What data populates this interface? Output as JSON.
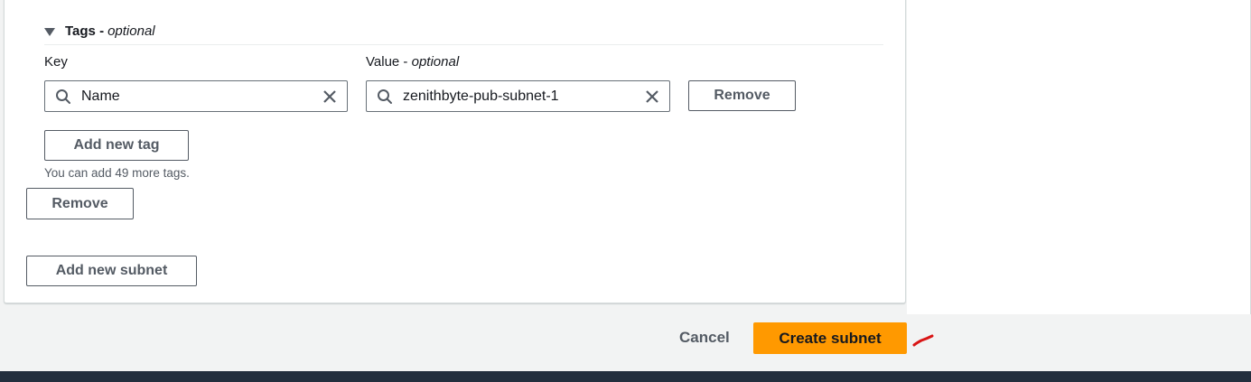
{
  "tags": {
    "title": "Tags",
    "title_optional": "optional",
    "key_label": "Key",
    "value_label": "Value",
    "value_optional": "optional",
    "row": {
      "key_value": "Name",
      "value_value": "zenithbyte-pub-subnet-1",
      "remove_label": "Remove"
    },
    "add_tag_label": "Add new tag",
    "hint": "You can add 49 more tags."
  },
  "subnet": {
    "remove_label": "Remove",
    "add_subnet_label": "Add new subnet"
  },
  "footer_actions": {
    "cancel_label": "Cancel",
    "create_label": "Create subnet"
  },
  "colors": {
    "primary": "#ff9900",
    "annotation": "#d91515",
    "footer_bar": "#232f3e"
  }
}
